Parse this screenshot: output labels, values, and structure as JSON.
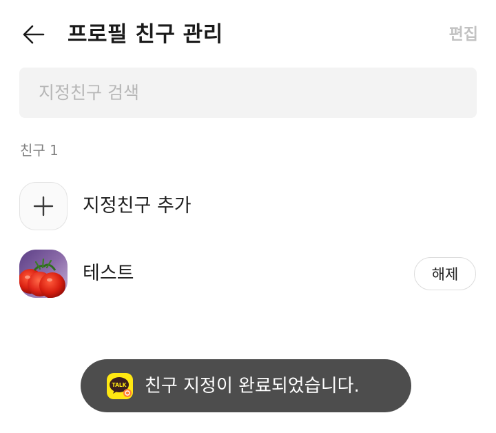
{
  "header": {
    "title": "프로필 친구 관리",
    "edit_label": "편집"
  },
  "search": {
    "placeholder": "지정친구 검색"
  },
  "section": {
    "label": "친구 1"
  },
  "list": {
    "add_label": "지정친구 추가",
    "friends": [
      {
        "name": "테스트",
        "action_label": "해제"
      }
    ]
  },
  "toast": {
    "logo_text": "TALK",
    "message": "친구 지정이 완료되었습니다."
  },
  "icons": {
    "back": "arrow-left-icon",
    "add": "plus-icon",
    "toast_logo": "kakaotalk-logo-icon"
  },
  "colors": {
    "kakao_yellow": "#FFE812",
    "toast_background": "#4D4D4D",
    "disabled_text": "#C2C2C2"
  }
}
